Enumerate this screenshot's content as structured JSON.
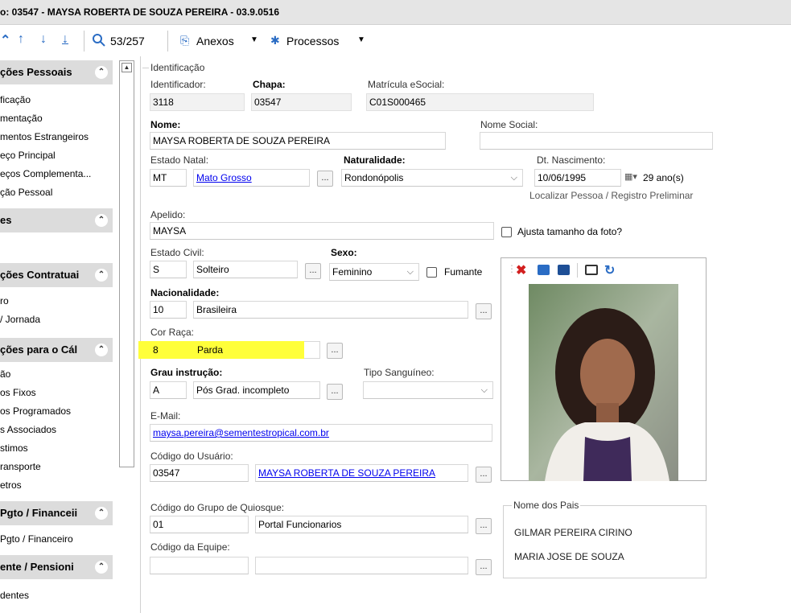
{
  "title": "o: 03547 - MAYSA ROBERTA DE SOUZA PEREIRA - 03.9.0516",
  "toolbar": {
    "counter": "53/257",
    "anexos": "Anexos",
    "processos": "Processos"
  },
  "sidebar": {
    "sections": [
      {
        "title": "ções Pessoais",
        "items": [
          "ficação",
          "mentação",
          "mentos Estrangeiros",
          "eço Principal",
          "eços Complementa...",
          "ção Pessoal"
        ]
      },
      {
        "title": "es",
        "items": []
      },
      {
        "title": "ções Contratuai",
        "items": [
          "ro",
          "/ Jornada"
        ]
      },
      {
        "title": "ções para o Cál",
        "items": [
          "ão",
          "os Fixos",
          "os Programados",
          "s Associados",
          "stimos",
          "ransporte",
          "etros"
        ]
      },
      {
        "title": "Pgto / Financeii",
        "items": [
          "Pgto / Financeiro"
        ]
      },
      {
        "title": "ente / Pensioni",
        "items": [
          "dentes"
        ]
      }
    ]
  },
  "form": {
    "section_title": "Identificação",
    "identificador": {
      "label": "Identificador:",
      "value": "3118"
    },
    "chapa": {
      "label": "Chapa:",
      "value": "03547"
    },
    "matricula": {
      "label": "Matrícula eSocial:",
      "value": "C01S000465"
    },
    "nome": {
      "label": "Nome:",
      "value": "MAYSA ROBERTA DE SOUZA PEREIRA"
    },
    "nome_social": {
      "label": "Nome Social:",
      "value": ""
    },
    "estado_natal": {
      "label": "Estado Natal:",
      "code": "MT",
      "name": "Mato Grosso"
    },
    "naturalidade": {
      "label": "Naturalidade:",
      "value": "Rondonópolis"
    },
    "dt_nascimento": {
      "label": "Dt. Nascimento:",
      "value": "10/06/1995",
      "age": "29 ano(s)"
    },
    "localizar_link": "Localizar Pessoa / Registro Preliminar",
    "apelido": {
      "label": "Apelido:",
      "value": "MAYSA"
    },
    "ajusta_foto": "Ajusta tamanho da foto?",
    "estado_civil": {
      "label": "Estado Civil:",
      "code": "S",
      "name": "Solteiro"
    },
    "sexo": {
      "label": "Sexo:",
      "value": "Feminino"
    },
    "fumante": "Fumante",
    "nacionalidade": {
      "label": "Nacionalidade:",
      "code": "10",
      "name": "Brasileira"
    },
    "cor_raca": {
      "label": "Cor Raça:",
      "code": "8",
      "name": "Parda"
    },
    "grau_instrucao": {
      "label": "Grau instrução:",
      "code": "A",
      "name": "Pós Grad. incompleto"
    },
    "tipo_sanguineo": {
      "label": "Tipo Sanguíneo:",
      "value": ""
    },
    "email": {
      "label": "E-Mail:",
      "value": "maysa.pereira@sementestropical.com.br"
    },
    "codigo_usuario": {
      "label": "Código do Usuário:",
      "code": "03547",
      "name": "MAYSA ROBERTA DE SOUZA PEREIRA"
    },
    "grupo_quiosque": {
      "label": "Código do Grupo de Quiosque:",
      "code": "01",
      "name": "Portal Funcionarios"
    },
    "equipe": {
      "label": "Código da Equipe:",
      "code": "",
      "name": ""
    },
    "pais": {
      "title": "Nome dos Pais",
      "pai": "GILMAR PEREIRA CIRINO",
      "mae": "MARIA JOSE DE SOUZA"
    }
  },
  "colors": {
    "highlight": "#ffff3a",
    "link": "#0000ee",
    "accent": "#2a6cc4"
  }
}
